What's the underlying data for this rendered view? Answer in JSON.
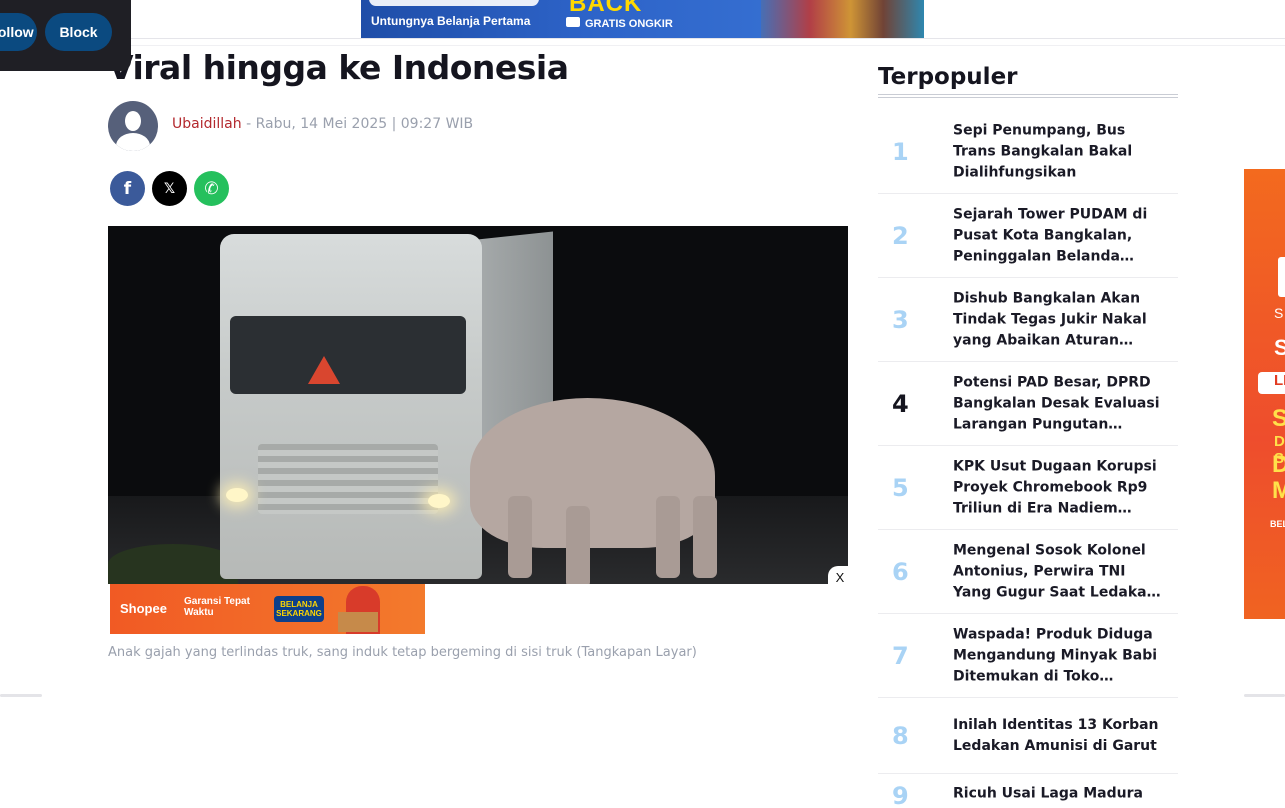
{
  "overlay": {
    "follow_label": "Follow",
    "block_label": "Block"
  },
  "top_ad": {
    "headline": "Untungnya Belanja Pertama",
    "big": "BACK",
    "ongkir": "GRATIS ONGKIR"
  },
  "article": {
    "headline": "Viral hingga ke Indonesia",
    "author": "Ubaidillah",
    "meta": " - Rabu, 14 Mei 2025 | 09:27 WIB",
    "share": {
      "facebook_glyph": "f",
      "x_glyph": "𝕏",
      "whatsapp_glyph": "✆"
    },
    "caption": "Anak gajah yang terlindas truk, sang induk tetap bergeming di sisi truk (Tangkapan Layar)",
    "close_glyph": "X"
  },
  "inline_ad": {
    "brand": "Shopee",
    "garansi": "Garansi Tepat Waktu",
    "cta": "BELANJA SEKARANG"
  },
  "sidebar": {
    "title": "Terpopuler",
    "items": [
      {
        "num": "1",
        "title": "Sepi Penumpang, Bus Trans Bangkalan Bakal Dialihfungsikan"
      },
      {
        "num": "2",
        "title": "Sejarah Tower PUDAM di Pusat Kota Bangkalan, Peninggalan Belanda yang Masih Berdiri"
      },
      {
        "num": "3",
        "title": "Dishub Bangkalan Akan Tindak Tegas Jukir Nakal yang Abaikan Aturan Parkir"
      },
      {
        "num": "4",
        "title": "Potensi PAD Besar, DPRD Bangkalan Desak Evaluasi Larangan Pungutan Retribusi"
      },
      {
        "num": "5",
        "title": "KPK Usut Dugaan Korupsi Proyek Chromebook Rp9 Triliun di Era Nadiem Makarim"
      },
      {
        "num": "6",
        "title": "Mengenal Sosok Kolonel Antonius, Perwira TNI Yang Gugur Saat Ledakan Amunisi"
      },
      {
        "num": "7",
        "title": "Waspada! Produk Diduga Mengandung Minyak Babi Ditemukan di Toko Modern"
      },
      {
        "num": "8",
        "title": "Inilah Identitas 13 Korban Ledakan Amunisi di Garut"
      },
      {
        "num": "9",
        "title": "Ricuh Usai Laga Madura"
      }
    ]
  },
  "right_ad": {
    "s": "S",
    "sh": "Sh",
    "li": "LI",
    "se": "SE",
    "di": "DI S",
    "dis": "DIS",
    "mu": "MU",
    "belanja": "BELAN"
  }
}
